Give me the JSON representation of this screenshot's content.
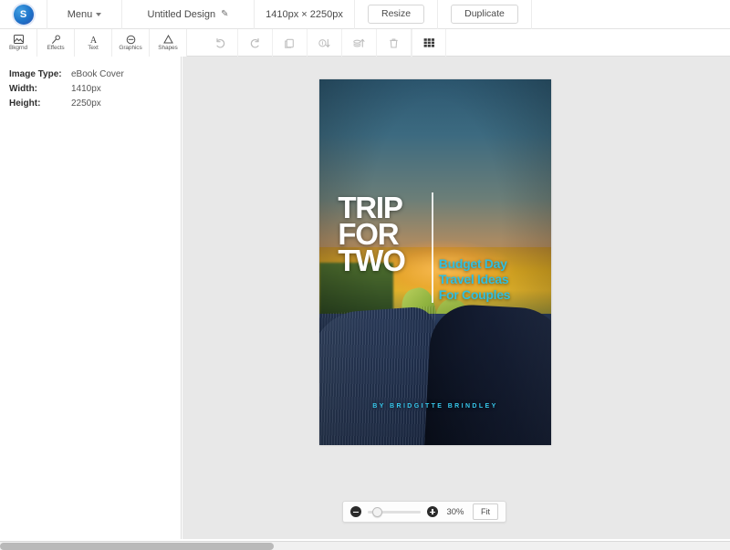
{
  "topbar": {
    "logo_letter": "S",
    "menu_label": "Menu",
    "design_title": "Untitled Design",
    "dimensions": "1410px × 2250px",
    "resize_label": "Resize",
    "duplicate_label": "Duplicate"
  },
  "tool_tabs": [
    {
      "label": "Bkgrnd",
      "icon": "background-icon"
    },
    {
      "label": "Effects",
      "icon": "magic-wand-icon"
    },
    {
      "label": "Text",
      "icon": "text-a-icon"
    },
    {
      "label": "Graphics",
      "icon": "graphics-circle-icon"
    },
    {
      "label": "Shapes",
      "icon": "triangle-shape-icon"
    }
  ],
  "actions": [
    {
      "name": "undo",
      "icon": "undo-arrow-icon"
    },
    {
      "name": "redo",
      "icon": "redo-arrow-icon"
    },
    {
      "name": "duplicate",
      "icon": "copy-icon"
    },
    {
      "name": "send-backward",
      "icon": "layer-down-icon"
    },
    {
      "name": "bring-forward",
      "icon": "layer-up-icon"
    },
    {
      "name": "delete",
      "icon": "trash-icon"
    },
    {
      "name": "grid",
      "icon": "grid-icon"
    }
  ],
  "info_panel": [
    {
      "key": "Image Type:",
      "value": "eBook Cover"
    },
    {
      "key": "Width:",
      "value": "1410px"
    },
    {
      "key": "Height:",
      "value": "2250px"
    }
  ],
  "cover": {
    "title_line1": "TRIP",
    "title_line2": "FOR",
    "title_line3": "TWO",
    "subtitle_line1": "Budget Day",
    "subtitle_line2": "Travel Ideas",
    "subtitle_line3": "For Couples",
    "byline": "BY BRIDGITTE BRINDLEY",
    "title_color": "#ffffff",
    "subtitle_color": "#30bfe0",
    "byline_color": "#36c6ea"
  },
  "zoom": {
    "percent": "30%",
    "fit_label": "Fit",
    "slider_value": 9
  }
}
